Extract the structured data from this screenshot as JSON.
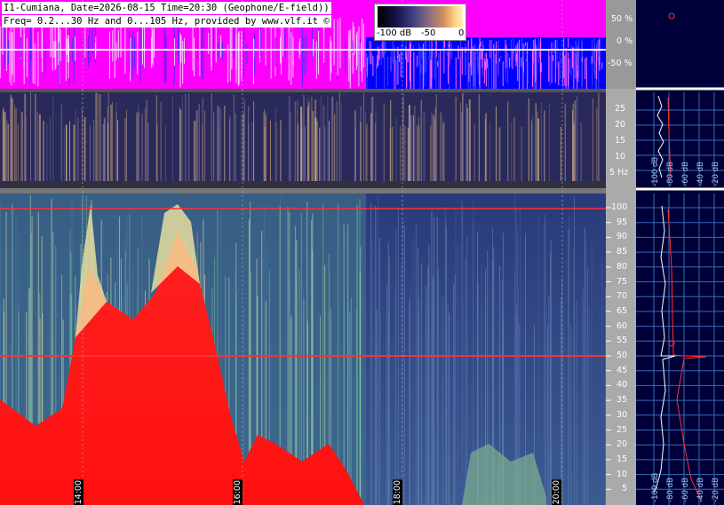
{
  "header": {
    "line1": "I1-Cumiana, Date=2026-08-15 Time=20:30 (Geophone/E-field))",
    "line2": "Freq= 0.2...30 Hz and 0...105 Hz, provided by www.vlf.it ©"
  },
  "colorbar": {
    "labels": [
      "-100 dB",
      "-50",
      "0"
    ]
  },
  "amplitude_panel": {
    "ticks": [
      "50 %",
      "0 %",
      "-50 %"
    ]
  },
  "low_freq_panel": {
    "ticks": [
      "25",
      "20",
      "15",
      "10",
      "5 Hz"
    ]
  },
  "high_freq_panel": {
    "ticks": [
      "100",
      "95",
      "90",
      "85",
      "80",
      "75",
      "70",
      "65",
      "60",
      "55",
      "50",
      "45",
      "40",
      "35",
      "30",
      "25",
      "20",
      "15",
      "10",
      "5"
    ]
  },
  "spectrum_axis_labels": [
    "-100 dB",
    "-80 dB",
    "-60 dB",
    "-40 dB",
    "-20 dB"
  ],
  "time_labels": [
    "14:00",
    "16:00",
    "18:00",
    "20:00"
  ],
  "colors": {
    "magenta": "#ff00ff",
    "blue": "#0000ff",
    "panel_bg": "#00003a",
    "grid_blue": "#3a78c8",
    "red_line": "#ff2a2a"
  }
}
